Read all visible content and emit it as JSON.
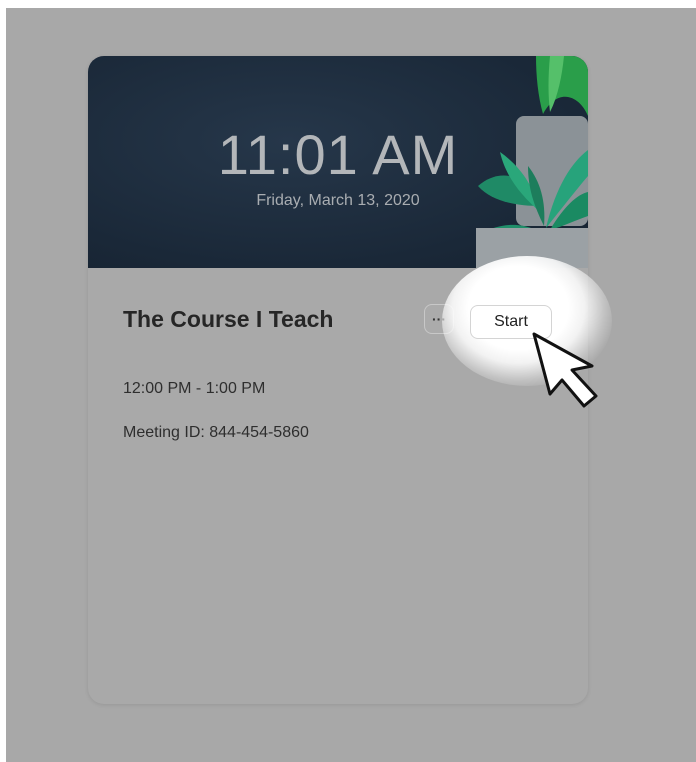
{
  "header": {
    "time": "11:01 AM",
    "date": "Friday, March 13, 2020"
  },
  "meeting": {
    "title": "The Course I Teach",
    "more_label": "···",
    "start_label": "Start",
    "time_range": "12:00 PM - 1:00 PM",
    "meeting_id": "Meeting ID: 844-454-5860"
  },
  "icons": {
    "more": "more-options-icon",
    "cursor": "arrow-cursor-icon",
    "illustration": "potted-plant-illustration"
  },
  "colors": {
    "header_bg": "#1b2a3a",
    "plant_green": "#2fa36b",
    "overlay": "#a8a8a8"
  }
}
